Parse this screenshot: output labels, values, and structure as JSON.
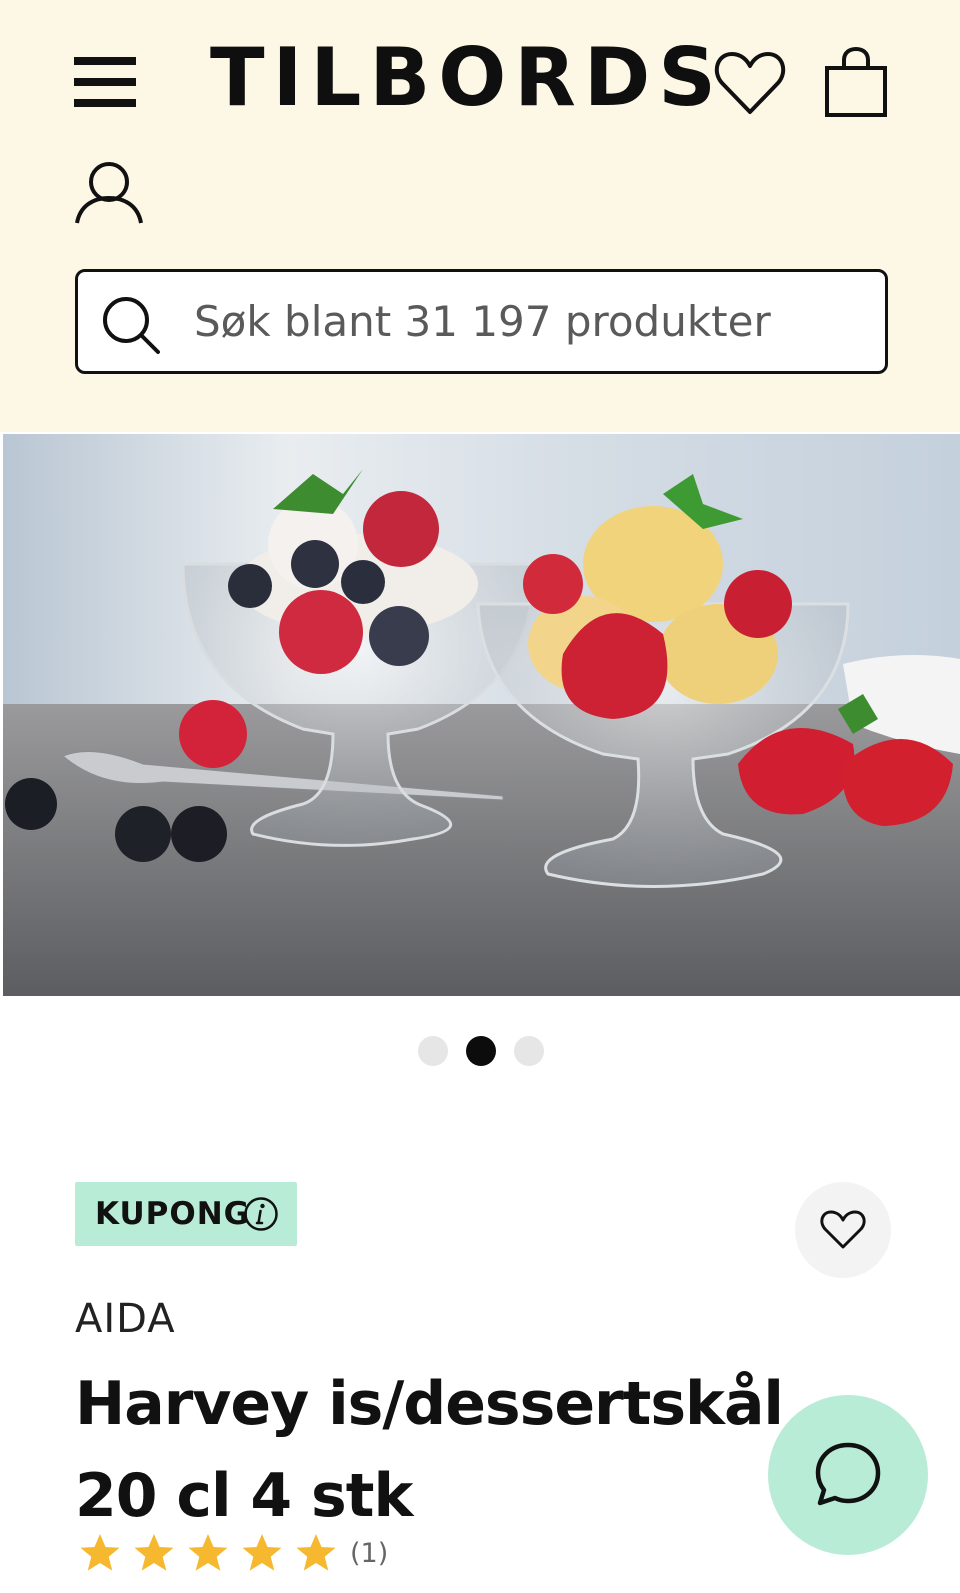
{
  "header": {
    "logo_text": "TILBORDS",
    "menu_icon": "hamburger-menu-icon",
    "wishlist_icon": "heart-icon",
    "cart_icon": "shopping-bag-icon",
    "account_icon": "user-icon",
    "background_color": "#fdf7e6"
  },
  "search": {
    "placeholder": "Søk blant 31 197 produkter",
    "value": "",
    "icon": "search-icon"
  },
  "gallery": {
    "image_alt": "Harvey is/dessertskål 20 cl 4 stk",
    "slide_count": 3,
    "active_slide": 2
  },
  "product": {
    "badge_label": "KUPONG",
    "badge_icon": "info-icon",
    "badge_color": "#b8ecd7",
    "brand": "AIDA",
    "title": "Harvey is/dessertskål 20 cl 4 stk",
    "rating": 5,
    "rating_max": 5,
    "review_count_label": "(1)",
    "star_color": "#f5b82e",
    "favorite_icon": "heart-icon"
  },
  "chat": {
    "icon": "chat-bubble-icon",
    "color": "#b8ecd7"
  }
}
